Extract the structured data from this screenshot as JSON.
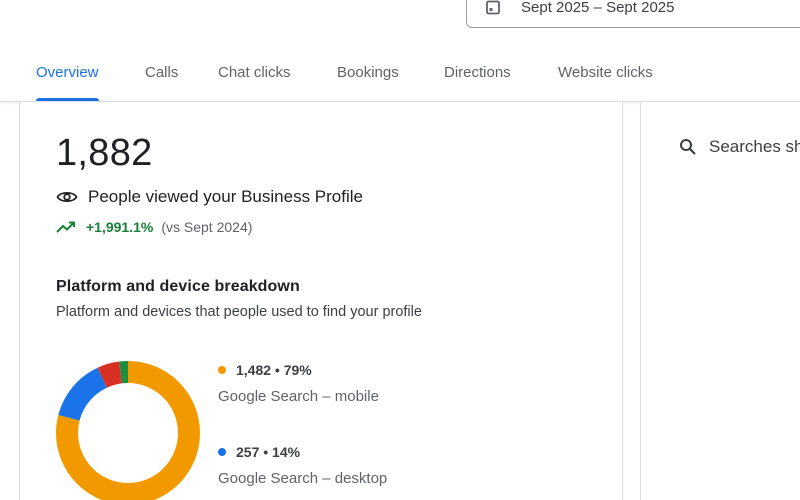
{
  "date_range": {
    "label": "Sept 2025 – Sept 2025",
    "icon": "calendar-icon"
  },
  "tabs": [
    {
      "label": "Overview",
      "active": true
    },
    {
      "label": "Calls",
      "active": false
    },
    {
      "label": "Chat clicks",
      "active": false
    },
    {
      "label": "Bookings",
      "active": false
    },
    {
      "label": "Directions",
      "active": false
    },
    {
      "label": "Website clicks",
      "active": false
    }
  ],
  "overview": {
    "value": "1,882",
    "label": "People viewed your Business Profile",
    "change": "+1,991.1%",
    "comparison": "(vs Sept 2024)"
  },
  "breakdown": {
    "title": "Platform and device breakdown",
    "subtitle": "Platform and devices that people used to find your profile",
    "segments": [
      {
        "stat": "1,482 • 79%",
        "name": "Google Search – mobile",
        "percent": 79,
        "color": "#f29900"
      },
      {
        "stat": "257 • 14%",
        "name": "Google Search – desktop",
        "percent": 14,
        "color": "#1a73e8"
      },
      {
        "percent": 5,
        "color": "#d93025"
      },
      {
        "percent": 2,
        "color": "#1e8e3e"
      }
    ]
  },
  "right_panel": {
    "heading": "Searches sh"
  },
  "colors": {
    "accent": "#1a73e8",
    "positive": "#188038"
  }
}
